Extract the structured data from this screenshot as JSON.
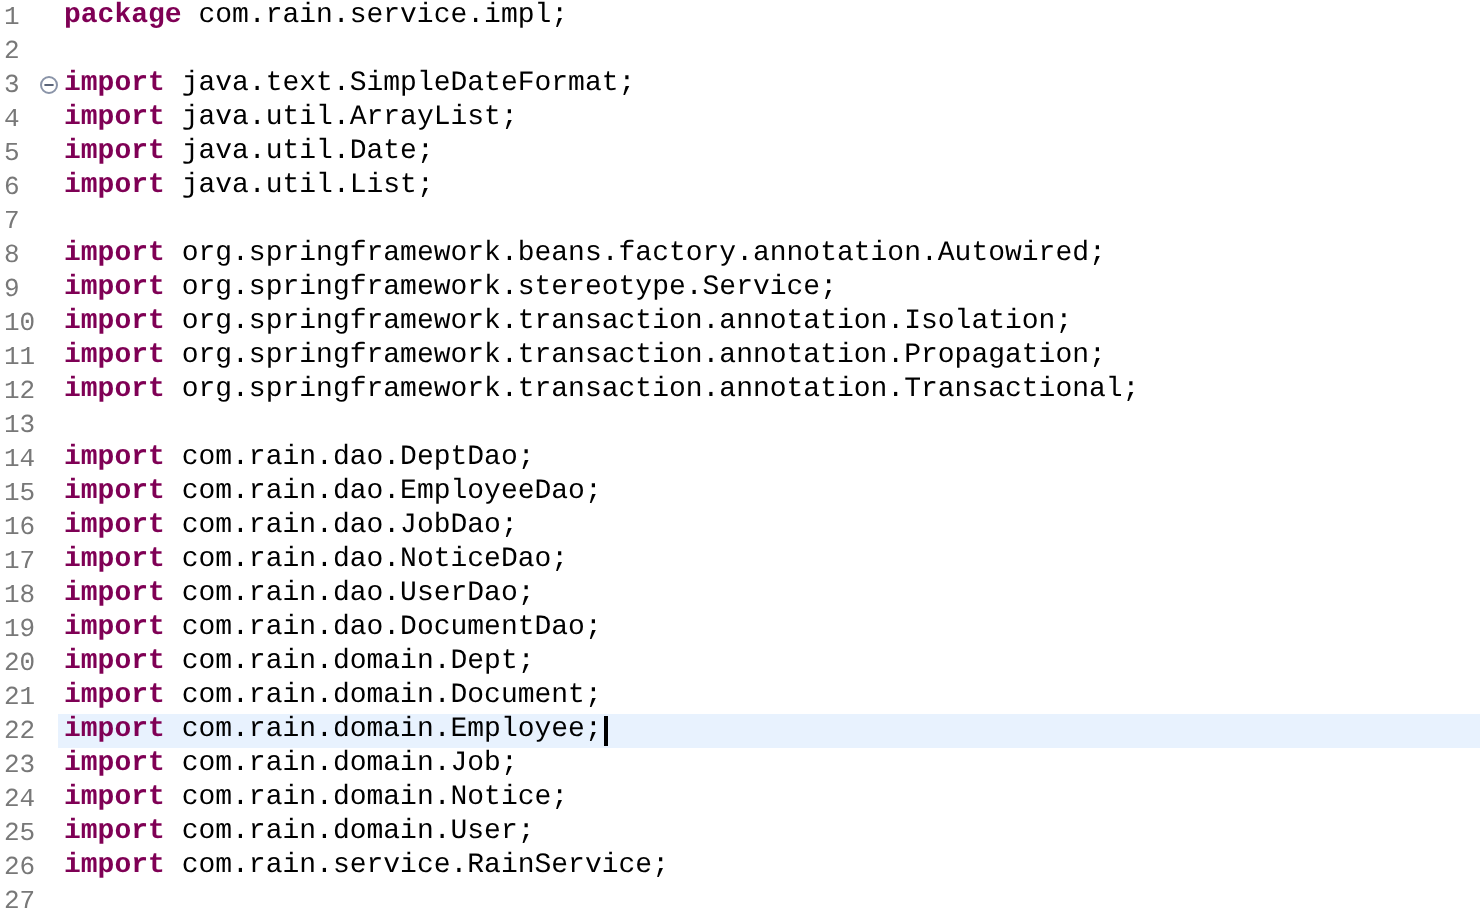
{
  "editor": {
    "lines": [
      {
        "number": "1",
        "keyword": "package",
        "code": "com.rain.service.impl;",
        "current": false
      },
      {
        "number": "2",
        "current": false
      },
      {
        "number": "3",
        "keyword": "import",
        "code": "java.text.SimpleDateFormat;",
        "current": false,
        "fold_expanded": true
      },
      {
        "number": "4",
        "keyword": "import",
        "code": "java.util.ArrayList;",
        "current": false
      },
      {
        "number": "5",
        "keyword": "import",
        "code": "java.util.Date;",
        "current": false
      },
      {
        "number": "6",
        "keyword": "import",
        "code": "java.util.List;",
        "current": false
      },
      {
        "number": "7",
        "current": false
      },
      {
        "number": "8",
        "keyword": "import",
        "code": "org.springframework.beans.factory.annotation.Autowired;",
        "current": false
      },
      {
        "number": "9",
        "keyword": "import",
        "code": "org.springframework.stereotype.Service;",
        "current": false
      },
      {
        "number": "10",
        "keyword": "import",
        "code": "org.springframework.transaction.annotation.Isolation;",
        "current": false
      },
      {
        "number": "11",
        "keyword": "import",
        "code": "org.springframework.transaction.annotation.Propagation;",
        "current": false
      },
      {
        "number": "12",
        "keyword": "import",
        "code": "org.springframework.transaction.annotation.Transactional;",
        "current": false
      },
      {
        "number": "13",
        "current": false
      },
      {
        "number": "14",
        "keyword": "import",
        "code": "com.rain.dao.DeptDao;",
        "current": false
      },
      {
        "number": "15",
        "keyword": "import",
        "code": "com.rain.dao.EmployeeDao;",
        "current": false
      },
      {
        "number": "16",
        "keyword": "import",
        "code": "com.rain.dao.JobDao;",
        "current": false
      },
      {
        "number": "17",
        "keyword": "import",
        "code": "com.rain.dao.NoticeDao;",
        "current": false
      },
      {
        "number": "18",
        "keyword": "import",
        "code": "com.rain.dao.UserDao;",
        "current": false
      },
      {
        "number": "19",
        "keyword": "import",
        "code": "com.rain.dao.DocumentDao;",
        "current": false
      },
      {
        "number": "20",
        "keyword": "import",
        "code": "com.rain.domain.Dept;",
        "current": false
      },
      {
        "number": "21",
        "keyword": "import",
        "code": "com.rain.domain.Document;",
        "current": false
      },
      {
        "number": "22",
        "keyword": "import",
        "code": "com.rain.domain.Employee;",
        "current": true
      },
      {
        "number": "23",
        "keyword": "import",
        "code": "com.rain.domain.Job;",
        "current": false
      },
      {
        "number": "24",
        "keyword": "import",
        "code": "com.rain.domain.Notice;",
        "current": false
      },
      {
        "number": "25",
        "keyword": "import",
        "code": "com.rain.domain.User;",
        "current": false
      },
      {
        "number": "26",
        "keyword": "import",
        "code": "com.rain.service.RainService;",
        "current": false
      },
      {
        "number": "27",
        "current": false
      }
    ]
  }
}
